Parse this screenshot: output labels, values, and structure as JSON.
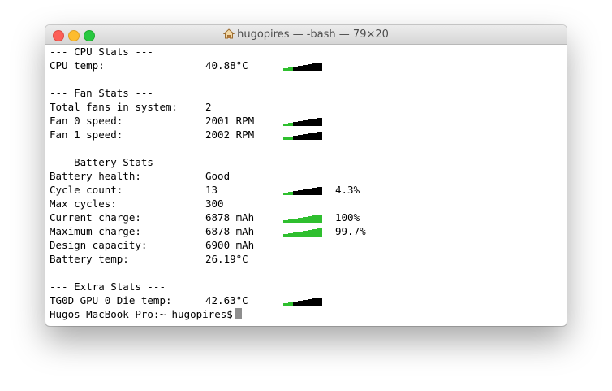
{
  "window": {
    "title": "hugopires — -bash — 79×20",
    "icon": "home-icon"
  },
  "colors": {
    "bar_on": "#2fbf2f",
    "bar_off": "#000000"
  },
  "rows": [
    {
      "label": "--- CPU Stats ---",
      "value": "",
      "level": null,
      "pct": ""
    },
    {
      "label": "CPU temp:",
      "value": "40.88°C",
      "level": 2,
      "pct": ""
    },
    {
      "label": "",
      "value": "",
      "level": null,
      "pct": ""
    },
    {
      "label": "--- Fan Stats ---",
      "value": "",
      "level": null,
      "pct": ""
    },
    {
      "label": "Total fans in system:",
      "value": "2",
      "level": null,
      "pct": ""
    },
    {
      "label": "Fan 0 speed:",
      "value": "2001 RPM",
      "level": 2,
      "pct": ""
    },
    {
      "label": "Fan 1 speed:",
      "value": "2002 RPM",
      "level": 2,
      "pct": ""
    },
    {
      "label": "",
      "value": "",
      "level": null,
      "pct": ""
    },
    {
      "label": "--- Battery Stats ---",
      "value": "",
      "level": null,
      "pct": ""
    },
    {
      "label": "Battery health:",
      "value": "Good",
      "level": null,
      "pct": ""
    },
    {
      "label": "Cycle count:",
      "value": "13",
      "level": 2,
      "pct": "4.3%"
    },
    {
      "label": "Max cycles:",
      "value": "300",
      "level": null,
      "pct": ""
    },
    {
      "label": "Current charge:",
      "value": "6878 mAh",
      "level": 8,
      "pct": "100%"
    },
    {
      "label": "Maximum charge:",
      "value": "6878 mAh",
      "level": 8,
      "pct": "99.7%"
    },
    {
      "label": "Design capacity:",
      "value": "6900 mAh",
      "level": null,
      "pct": ""
    },
    {
      "label": "Battery temp:",
      "value": "26.19°C",
      "level": null,
      "pct": ""
    },
    {
      "label": "",
      "value": "",
      "level": null,
      "pct": ""
    },
    {
      "label": "--- Extra Stats ---",
      "value": "",
      "level": null,
      "pct": ""
    },
    {
      "label": "TG0D GPU 0 Die temp:",
      "value": "42.63°C",
      "level": 2,
      "pct": ""
    }
  ],
  "prompt": "Hugos-MacBook-Pro:~ hugopires$"
}
